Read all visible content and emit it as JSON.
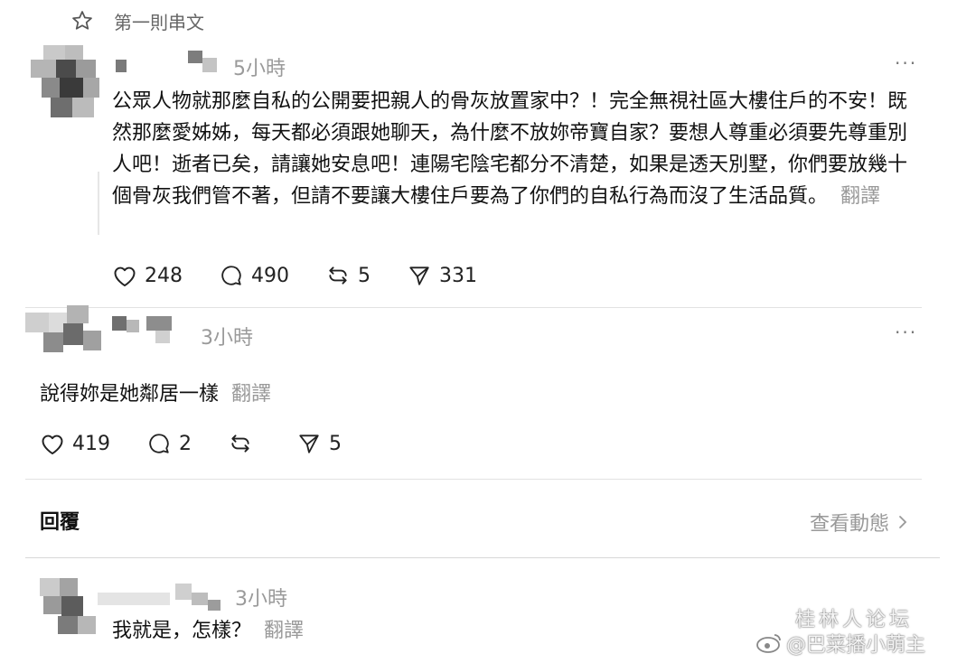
{
  "thread_header": {
    "star_icon": "star-icon",
    "title": "第一則串文"
  },
  "post": {
    "time": "5小時",
    "more": "···",
    "text": "公眾人物就那麼自私的公開要把親人的骨灰放置家中？！完全無視社區大樓住戶的不安！既然那麼愛姊姊，每天都必須跟她聊天，為什麼不放妳帝寶自家？要想人尊重必須要先尊重別人吧！逝者已矣，請讓她安息吧！連陽宅陰宅都分不清楚，如果是透天別墅，你們要放幾十個骨灰我們管不著，但請不要讓大樓住戶要為了你們的自私行為而沒了生活品質。",
    "translate": "翻譯",
    "likes": "248",
    "comments": "490",
    "reposts": "5",
    "shares": "331"
  },
  "reply1": {
    "time": "3小時",
    "more": "···",
    "text": "說得妳是她鄰居一樣",
    "translate": "翻譯",
    "likes": "419",
    "comments": "2",
    "reposts": "",
    "shares": "5"
  },
  "reply_bar": {
    "label": "回覆",
    "activity": "查看動態"
  },
  "reply2": {
    "time": "3小時",
    "text": "我就是，怎樣？",
    "translate": "翻譯"
  },
  "watermark": {
    "line1": "桂林人论坛",
    "line2": "@巴菜播小萌主"
  }
}
